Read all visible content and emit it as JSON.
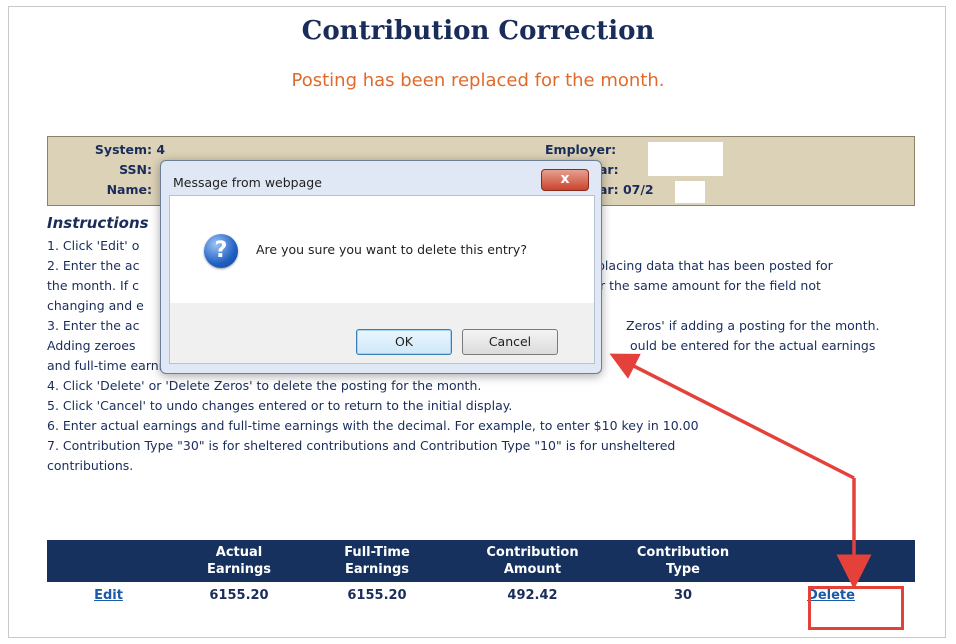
{
  "page": {
    "title": "Contribution Correction",
    "status_message": "Posting has been replaced for the month."
  },
  "info": {
    "system_label": "System:",
    "system_value": "4",
    "ssn_label": "SSN:",
    "name_label": "Name:",
    "employer_label": "Employer:",
    "year_label": "ar:",
    "reporting_label": "ar:",
    "reporting_value": "07/2"
  },
  "instructions": {
    "heading": "Instructions",
    "lines": [
      "1. Click 'Edit' o",
      "2. Enter the ac",
      "placing data that has been posted for",
      "the month. If c",
      "r the same amount for the field not",
      "changing and e",
      "3. Enter the ac",
      "Zeros' if adding a posting for the month.",
      "Adding zeroes",
      "ould be entered for the actual earnings",
      "and full-time earnings. Full-time earnings are required for the rest of the months.",
      "4. Click 'Delete' or 'Delete Zeros' to delete the posting for the month.",
      "5. Click 'Cancel' to undo changes entered or to return to the initial display.",
      "6. Enter actual earnings and full-time earnings with the decimal. For example, to enter $10 key in 10.00",
      "7. Contribution Type \"30\" is for sheltered contributions and Contribution Type \"10\" is for unsheltered",
      "contributions."
    ]
  },
  "table": {
    "headers": [
      {
        "line1": "",
        "line2": ""
      },
      {
        "line1": "Actual",
        "line2": "Earnings"
      },
      {
        "line1": "Full-Time",
        "line2": "Earnings"
      },
      {
        "line1": "Contribution",
        "line2": "Amount"
      },
      {
        "line1": "Contribution",
        "line2": "Type"
      },
      {
        "line1": "",
        "line2": ""
      }
    ],
    "row": {
      "edit": "Edit",
      "actual_earnings": "6155.20",
      "full_time_earnings": "6155.20",
      "contribution_amount": "492.42",
      "contribution_type": "30",
      "delete": "Delete"
    }
  },
  "dialog": {
    "title": "Message from webpage",
    "close_glyph": "x",
    "icon_glyph": "?",
    "message": "Are you sure you want to delete this entry?",
    "ok_label": "OK",
    "cancel_label": "Cancel"
  },
  "colors": {
    "title": "#1a2d5a",
    "status": "#e06a2b",
    "header_bg": "#16315e",
    "annotation": "#e4413b"
  }
}
